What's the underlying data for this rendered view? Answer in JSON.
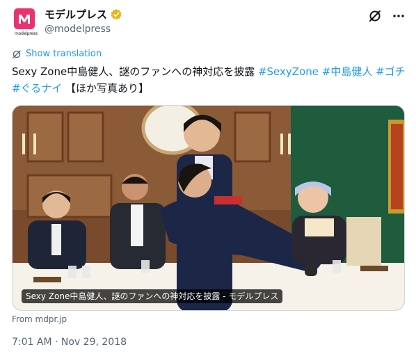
{
  "account": {
    "display_name": "モデルプレス",
    "handle": "@modelpress",
    "avatar_brand": "modelpress"
  },
  "tweet": {
    "translate_label": "Show translation",
    "text_segments": [
      {
        "text": "Sexy Zone中島健人、謎のファンへの神対応を披露 ",
        "hashtag": false
      },
      {
        "text": "#SexyZone",
        "hashtag": true
      },
      {
        "text": " ",
        "hashtag": false
      },
      {
        "text": "#中島健人",
        "hashtag": true
      },
      {
        "text": " ",
        "hashtag": false
      },
      {
        "text": "#ゴチ",
        "hashtag": true
      },
      {
        "text": " ",
        "hashtag": false
      },
      {
        "text": "#ぐるナイ",
        "hashtag": true
      },
      {
        "text": " 【ほか写真あり】",
        "hashtag": false
      }
    ],
    "media_caption": "Sexy Zone中島健人、謎のファンへの神対応を披露 - モデルプレス",
    "source": "From mdpr.jp",
    "timestamp": "7:01 AM · Nov 29, 2018"
  },
  "icons": {
    "verified": "verified-badge-icon",
    "grok": "slashed-circle-icon",
    "more": "more-dots-icon",
    "translate": "slashed-circle-icon"
  },
  "colors": {
    "link": "#1d9bf0",
    "secondary_text": "#536471",
    "verified_gold": "#e2b719",
    "brand_pink": "#e8336f"
  }
}
